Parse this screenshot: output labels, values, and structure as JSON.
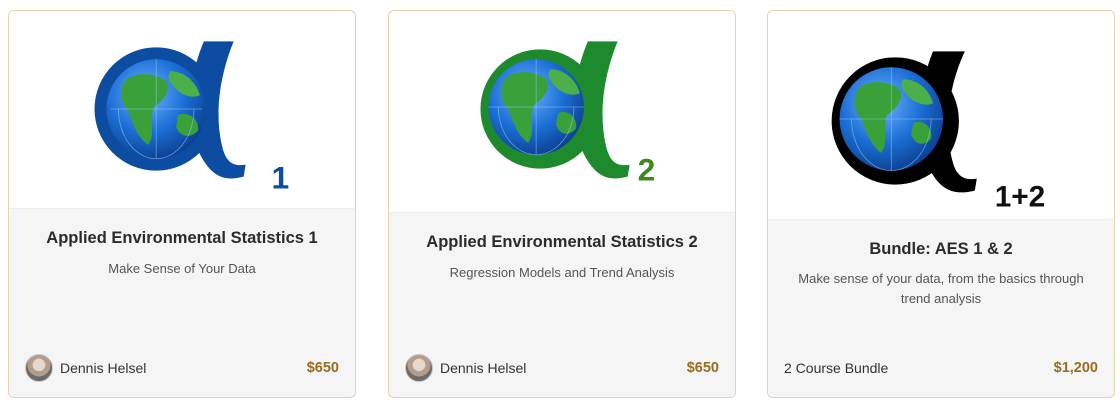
{
  "colors": {
    "price": "#9a6b1c",
    "card_border": "#e2d3b3",
    "alpha_course1": "#0d4da1",
    "alpha_course2": "#1e8a2e",
    "alpha_bundle": "#000000",
    "subscript_course1": "#0d4da1",
    "subscript_course2": "#3d8a1a",
    "subscript_bundle": "#111111"
  },
  "cards": [
    {
      "logo_subscript": "1",
      "title": "Applied Environmental Statistics 1",
      "subtitle": "Make Sense of Your Data",
      "author": "Dennis Helsel",
      "price": "$650"
    },
    {
      "logo_subscript": "2",
      "title": "Applied Environmental Statistics 2",
      "subtitle": "Regression Models and Trend Analysis",
      "author": "Dennis Helsel",
      "price": "$650"
    },
    {
      "logo_subscript": "1+2",
      "title": "Bundle: AES 1 & 2",
      "subtitle": "Make sense of your data, from the basics through trend analysis",
      "bundle_label": "2 Course Bundle",
      "price": "$1,200"
    }
  ]
}
